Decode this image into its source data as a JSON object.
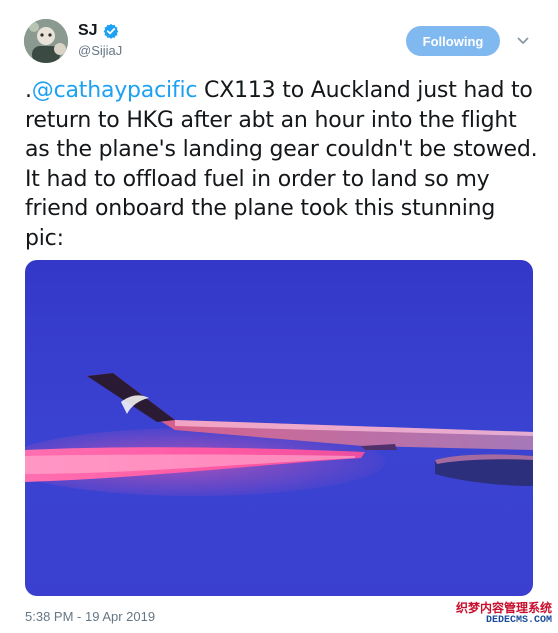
{
  "author": {
    "display_name": "SJ",
    "handle": "@SijiaJ",
    "avatar": "user-avatar",
    "verified_icon": "verified-badge-icon"
  },
  "actions": {
    "follow_label": "Following",
    "menu_icon": "chevron-down-icon"
  },
  "tweet": {
    "prefix": ".",
    "mention": "@cathaypacific",
    "body": " CX113 to Auckland just had to return to HKG after abt an hour into the flight as the plane's landing gear couldn't be stowed. It had to offload fuel in order to land so my friend onboard the plane took this stunning pic:"
  },
  "media": {
    "description_icon": "airplane-wing-photo"
  },
  "meta": {
    "timestamp": "5:38 PM - 19 Apr 2019"
  },
  "watermark": {
    "line1": "织梦内容管理系统",
    "line2": "DEDECMS.COM"
  },
  "colors": {
    "follow_button": "#7fb9f0",
    "link": "#1da1f2",
    "secondary_text": "#657786",
    "sky": "#3a3fd0",
    "fuel_trail": "#ff4f9a"
  }
}
